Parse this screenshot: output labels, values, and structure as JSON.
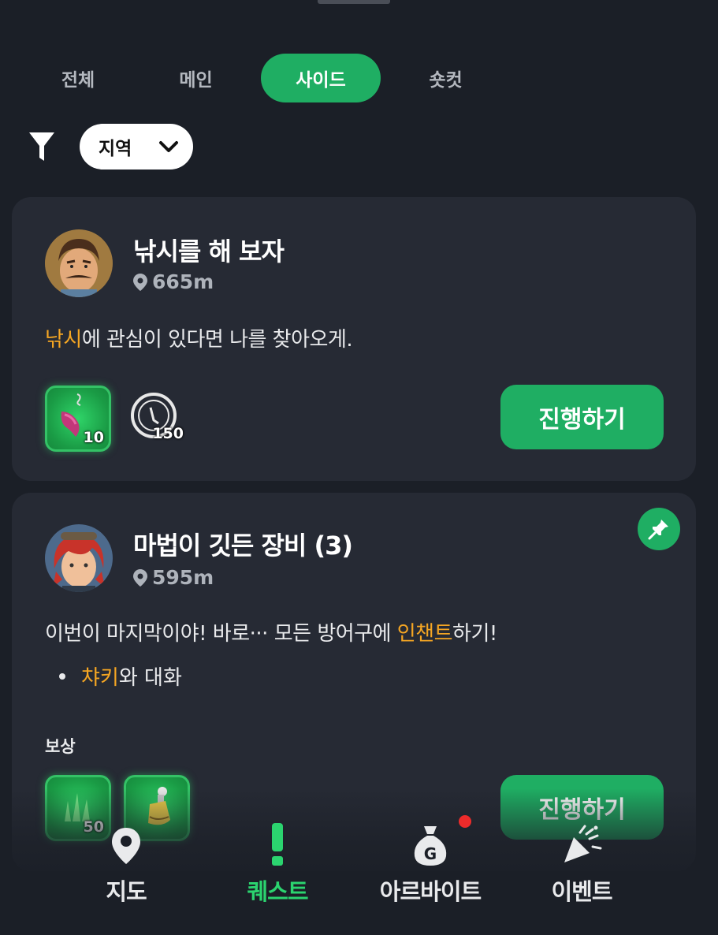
{
  "tabs": [
    {
      "label": "전체",
      "active": false
    },
    {
      "label": "메인",
      "active": false
    },
    {
      "label": "사이드",
      "active": true
    },
    {
      "label": "숏컷",
      "active": false
    }
  ],
  "filter": {
    "region_label": "지역"
  },
  "quests": [
    {
      "title": "낚시를 해 보자",
      "distance": "665m",
      "desc_highlight": "낚시",
      "desc_rest": "에 관심이 있다면 나를 찾아오게.",
      "rewards": [
        {
          "icon": "fishing-rod-icon",
          "count": "10"
        },
        {
          "icon": "timer-dial-icon",
          "count": "150"
        }
      ],
      "button": "진행하기"
    },
    {
      "title": "마법이 깃든 장비 (3)",
      "distance": "595m",
      "desc_before": "이번이 마지막이야! 바로··· 모든 방어구에 ",
      "desc_highlight": "인챈트",
      "desc_after": "하기!",
      "objective_highlight": "챠키",
      "objective_rest": "와 대화",
      "reward_label": "보상",
      "rewards": [
        {
          "icon": "herb-grass-icon",
          "count": "50"
        },
        {
          "icon": "potion-bottle-icon",
          "count": ""
        }
      ],
      "button": "진행하기",
      "pinned": true
    }
  ],
  "nav": [
    {
      "label": "지도",
      "icon": "map-pin-icon",
      "active": false
    },
    {
      "label": "퀘스트",
      "icon": "exclamation-icon",
      "active": true
    },
    {
      "label": "아르바이트",
      "icon": "money-bag-icon",
      "active": false,
      "badge": true
    },
    {
      "label": "이벤트",
      "icon": "party-popper-icon",
      "active": false
    }
  ],
  "colors": {
    "accent": "#1fae63",
    "highlight": "#f5a623",
    "background": "#1b1f27",
    "card": "#262a34",
    "badge": "#ee2b2b"
  }
}
